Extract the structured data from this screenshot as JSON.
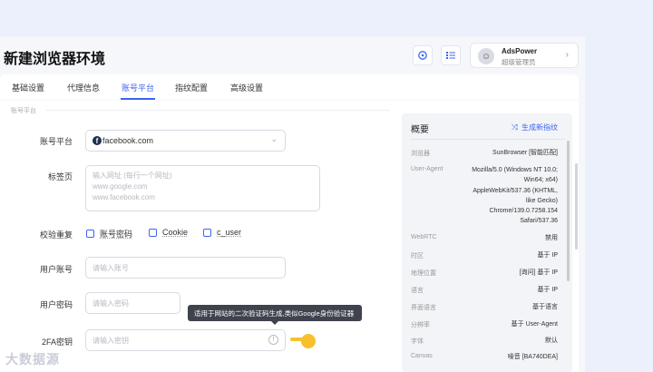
{
  "window": {
    "title": "新建浏览器环境"
  },
  "header": {
    "refresh_icon": "refresh-icon",
    "list_icon": "list-icon",
    "account": {
      "name": "AdsPower",
      "role": "超级管理员"
    }
  },
  "tabs": [
    {
      "label": "基础设置"
    },
    {
      "label": "代理信息"
    },
    {
      "label": "账号平台",
      "active": true
    },
    {
      "label": "指纹配置"
    },
    {
      "label": "高级设置"
    }
  ],
  "form": {
    "section_title": "账号平台",
    "platform": {
      "label": "账号平台",
      "value": "facebook.com",
      "fb_letter": "f"
    },
    "tabs_field": {
      "label": "标签页",
      "placeholder_lines": [
        "输入网址 (每行一个网址)",
        "www.google.com",
        "www.facebook.com"
      ]
    },
    "verify_dup": {
      "label": "校验重复",
      "options": [
        "账号密码",
        "Cookie",
        "c_user"
      ]
    },
    "username": {
      "label": "用户账号",
      "placeholder": "请输入账号"
    },
    "password": {
      "label": "用户密码",
      "placeholder": "请输入密码"
    },
    "twofa": {
      "label": "2FA密钥",
      "placeholder": "请输入密钥",
      "info": "!"
    },
    "tooltip": "适用于网站的二次验证码生成,类似Google身份验证器"
  },
  "overview": {
    "title": "概要",
    "generate_label": "生成新指纹",
    "rows": [
      {
        "k": "浏览器",
        "v": "SunBrowser [智能匹配]"
      },
      {
        "k": "User-Agent",
        "v": "Mozilla/5.0 (Windows NT 10.0; Win64; x64) AppleWebKit/537.36 (KHTML, like Gecko) Chrome/139.0.7258.154 Safari/537.36"
      },
      {
        "k": "WebRTC",
        "v": "禁用"
      },
      {
        "k": "时区",
        "v": "基于 IP"
      },
      {
        "k": "地理位置",
        "v": "[询问] 基于 IP"
      },
      {
        "k": "语言",
        "v": "基于 IP"
      },
      {
        "k": "界面语言",
        "v": "基于语言"
      },
      {
        "k": "分辨率",
        "v": "基于 User-Agent"
      },
      {
        "k": "字体",
        "v": "默认"
      },
      {
        "k": "Canvas",
        "v": "噪音 [BA740DEA]"
      }
    ]
  },
  "watermark": {
    "text": "大数据源",
    "sub": ""
  },
  "colors": {
    "accent": "#3d63f2",
    "bg": "#eceffc"
  }
}
